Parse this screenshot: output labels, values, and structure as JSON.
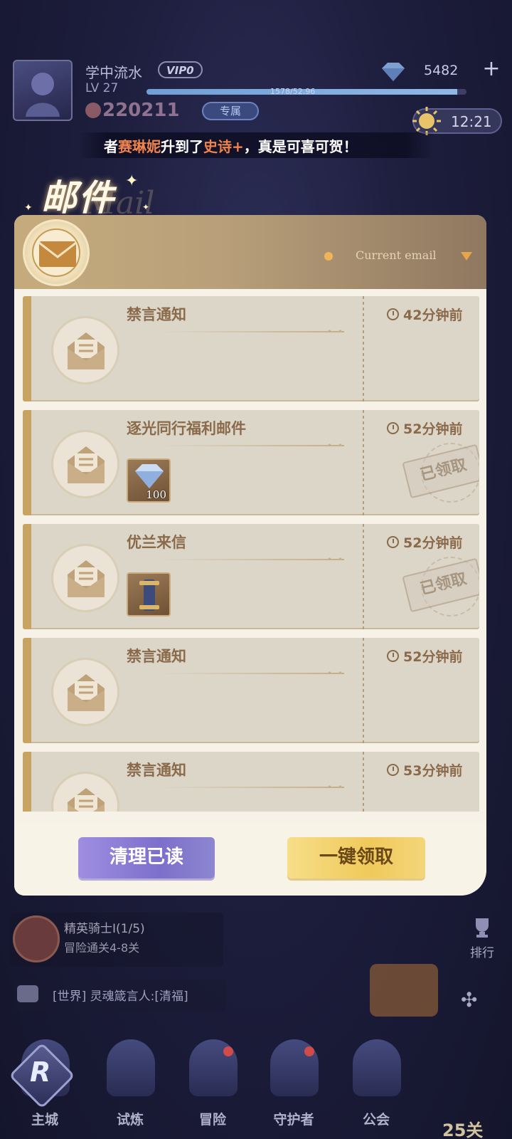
{
  "player": {
    "name": "学中流水",
    "vip": "VIP0",
    "level": "LV 27",
    "exp_text": "1578/52.96",
    "exp_fraction": 0.97,
    "power": "220211",
    "badge_label": "专属"
  },
  "resources": {
    "gems": "5482",
    "plus": "+",
    "time": "12:21"
  },
  "ticker": {
    "prefix": "者",
    "name": "赛琳妮",
    "middle": "升到了",
    "rank": "史诗+",
    "suffix": "，真是可喜可贺！"
  },
  "mail_panel": {
    "title": "邮件",
    "title_en": "Mail",
    "filter_label": "Current email",
    "mails": [
      {
        "subject": "禁言通知",
        "time": "42分钟前",
        "item": null,
        "claimed": false
      },
      {
        "subject": "逐光同行福利邮件",
        "time": "52分钟前",
        "item": {
          "name": "diamond",
          "qty": "100"
        },
        "claimed": true
      },
      {
        "subject": "优兰来信",
        "time": "52分钟前",
        "item": {
          "name": "scroll",
          "qty": ""
        },
        "claimed": true
      },
      {
        "subject": "禁言通知",
        "time": "52分钟前",
        "item": null,
        "claimed": false
      },
      {
        "subject": "禁言通知",
        "time": "53分钟前",
        "item": null,
        "claimed": false
      }
    ],
    "claimed_stamp": "已领取",
    "clear_button": "清理已读",
    "claim_all_button": "一键领取"
  },
  "bottom": {
    "quest_title": "精英骑士I(1/5)",
    "quest_sub": "冒险通关4-8关",
    "rank_label": "排行",
    "chat_text": "[世界] 灵魂箴言人:[清福]",
    "nav": [
      "主城",
      "试炼",
      "冒险",
      "守护者",
      "公会"
    ],
    "stage": "25关"
  },
  "colors": {
    "accent_gold": "#c8a464",
    "clear_purple": "#7c6fcb",
    "claim_yellow": "#f0c95a",
    "ticker_highlight": "#f0834c"
  }
}
